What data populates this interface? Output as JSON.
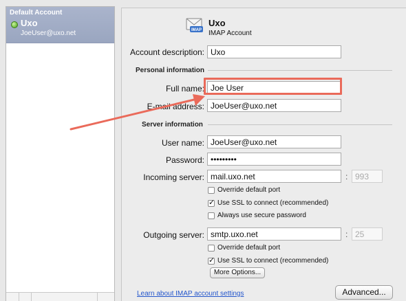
{
  "sidebar": {
    "group_label": "Default Account",
    "account_name": "Uxo",
    "account_email": "JoeUser@uxo.net"
  },
  "header": {
    "account_title": "Uxo",
    "account_type": "IMAP Account",
    "icon_text": "IMAP"
  },
  "form": {
    "account_description_label": "Account description:",
    "account_description_value": "Uxo",
    "personal_section": "Personal information",
    "full_name_label": "Full name:",
    "full_name_value": "Joe User",
    "email_label": "E-mail address:",
    "email_value": "JoeUser@uxo.net",
    "server_section": "Server information",
    "username_label": "User name:",
    "username_value": "JoeUser@uxo.net",
    "password_label": "Password:",
    "password_value": "•••••••••",
    "incoming_label": "Incoming server:",
    "incoming_value": "mail.uxo.net",
    "incoming_port": "993",
    "incoming_override_label": "Override default port",
    "incoming_override_checked": false,
    "incoming_ssl_label": "Use SSL to connect (recommended)",
    "incoming_ssl_checked": true,
    "secure_password_label": "Always use secure password",
    "secure_password_checked": false,
    "outgoing_label": "Outgoing server:",
    "outgoing_value": "smtp.uxo.net",
    "outgoing_port": "25",
    "outgoing_override_label": "Override default port",
    "outgoing_override_checked": false,
    "outgoing_ssl_label": "Use SSL to connect (recommended)",
    "outgoing_ssl_checked": true,
    "colon": ":"
  },
  "buttons": {
    "more_options": "More Options...",
    "advanced": "Advanced..."
  },
  "links": {
    "learn_more": "Learn about IMAP account settings"
  },
  "colors": {
    "highlight": "#ea6a5a",
    "selection": "#9aa6c0",
    "link": "#2255cc"
  }
}
